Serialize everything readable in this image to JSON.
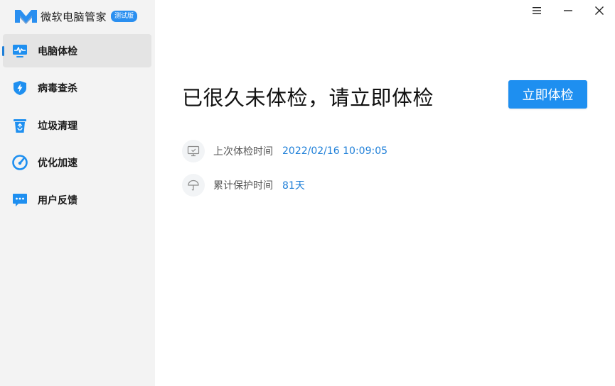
{
  "app": {
    "name": "微软电脑管家",
    "badge": "测试版"
  },
  "window_controls": {
    "menu_icon": "menu-icon",
    "minimize_icon": "minimize-icon",
    "close_icon": "close-icon"
  },
  "sidebar": {
    "items": [
      {
        "label": "电脑体检",
        "icon": "monitor-pulse-icon",
        "active": true
      },
      {
        "label": "病毒查杀",
        "icon": "shield-bolt-icon",
        "active": false
      },
      {
        "label": "垃圾清理",
        "icon": "recycle-bin-icon",
        "active": false
      },
      {
        "label": "优化加速",
        "icon": "speedometer-icon",
        "active": false
      },
      {
        "label": "用户反馈",
        "icon": "chat-bubble-icon",
        "active": false
      }
    ]
  },
  "main": {
    "headline": "已很久未体检，请立即体检",
    "action_button": "立即体检",
    "info": [
      {
        "label": "上次体检时间",
        "value": "2022/02/16 10:09:05",
        "icon": "monitor-icon"
      },
      {
        "label": "累计保护时间",
        "value": "81天",
        "icon": "umbrella-icon"
      }
    ]
  },
  "colors": {
    "accent": "#1e8ff0",
    "sidebar_bg": "#f3f3f3",
    "active_item_bg": "#e4e4e4",
    "value_text": "#1e7fd8"
  }
}
